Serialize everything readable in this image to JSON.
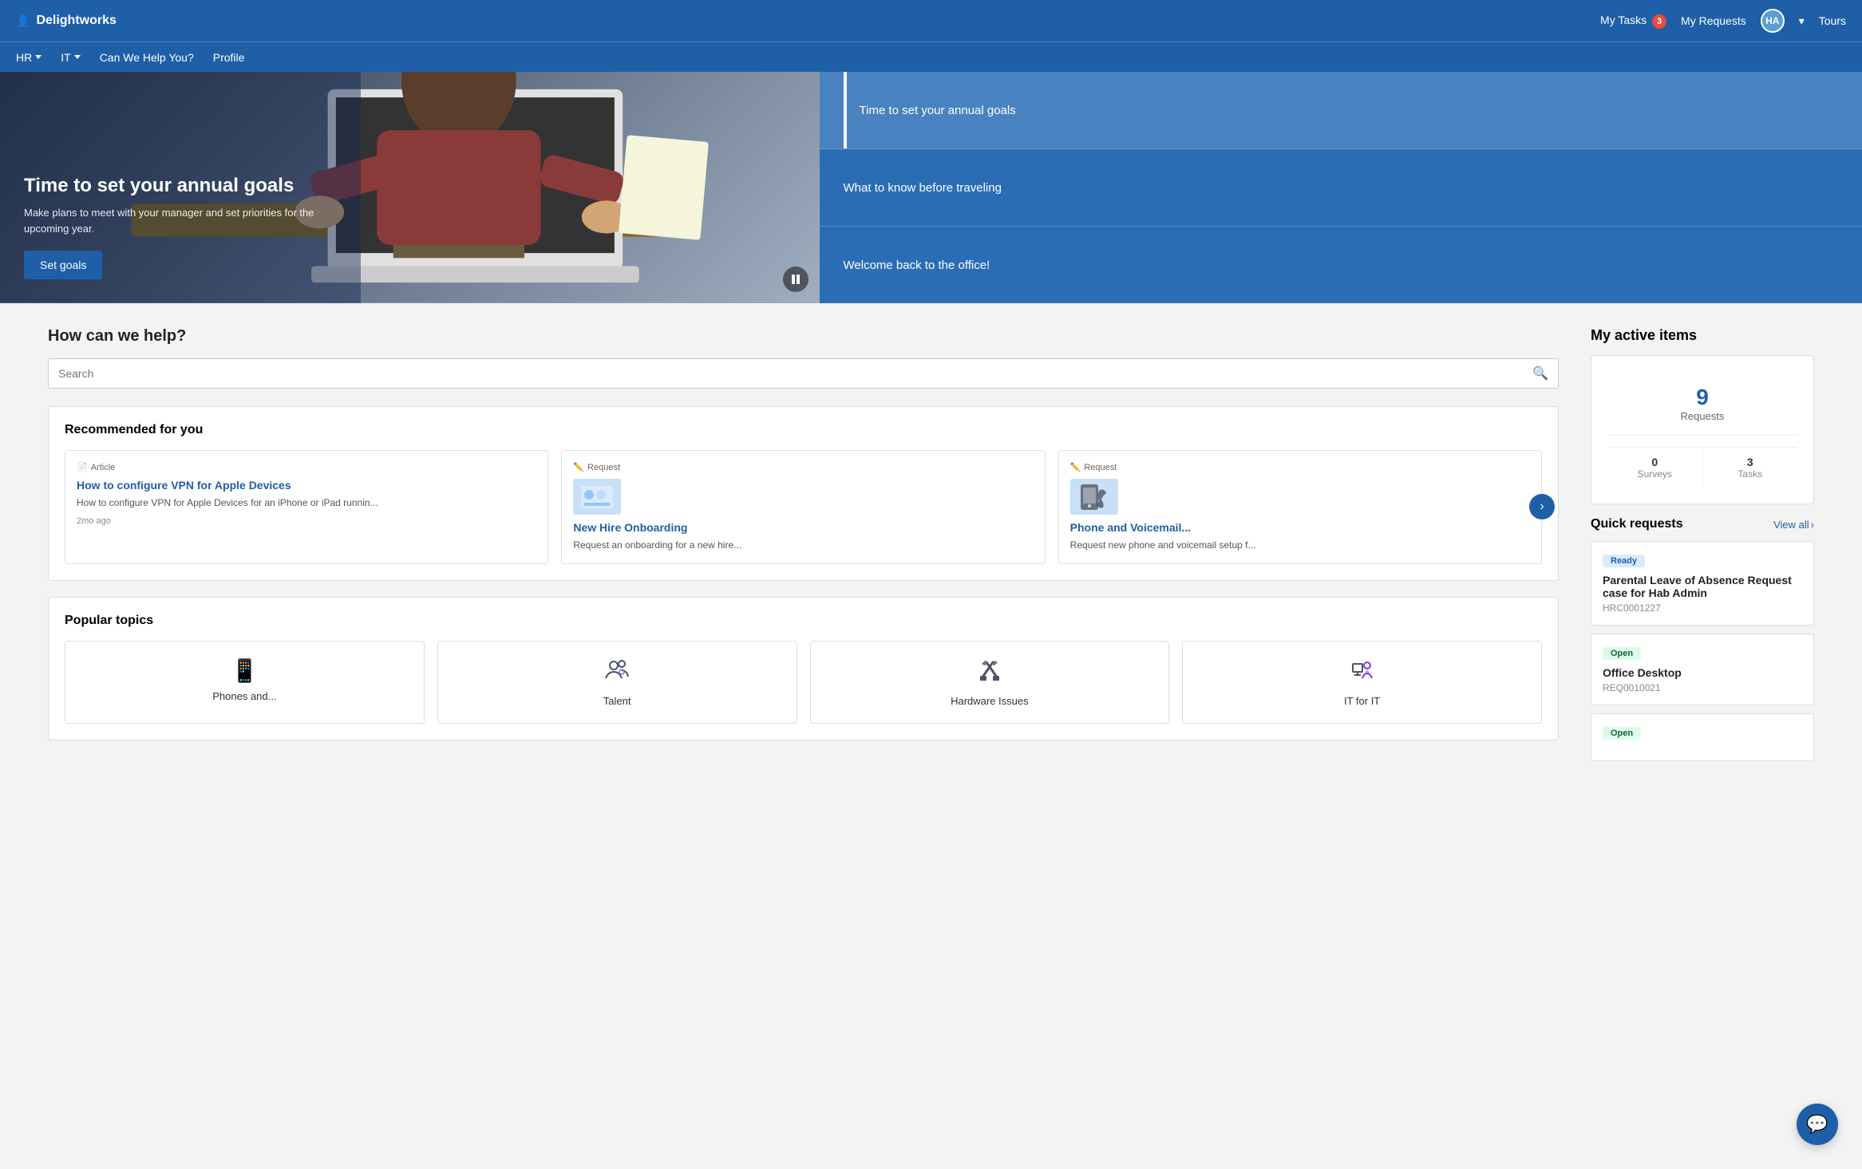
{
  "topbar": {
    "logo": "Delightworks",
    "logo_icon": "👤",
    "my_tasks": "My Tasks",
    "tasks_count": "3",
    "my_requests": "My Requests",
    "avatar_initials": "HA",
    "tours": "Tours",
    "dropdown_arrow": "▾"
  },
  "secondary_nav": {
    "items": [
      {
        "label": "HR",
        "has_dropdown": true
      },
      {
        "label": "IT",
        "has_dropdown": true
      },
      {
        "label": "Can We Help You?",
        "has_dropdown": false
      },
      {
        "label": "Profile",
        "has_dropdown": false
      }
    ]
  },
  "hero": {
    "title": "Time to set your annual goals",
    "subtitle": "Make plans to meet with your manager and set priorities for the upcoming year.",
    "cta_label": "Set goals",
    "sidebar_items": [
      {
        "label": "Time to set your annual goals",
        "active": true
      },
      {
        "label": "What to know before traveling",
        "active": false
      },
      {
        "label": "Welcome back to the office!",
        "active": false
      }
    ]
  },
  "help_section": {
    "title": "How can we help?",
    "search_placeholder": "Search"
  },
  "recommended": {
    "section_title": "Recommended for you",
    "next_btn": "›",
    "items": [
      {
        "type": "Article",
        "type_icon": "📄",
        "title": "How to configure VPN for Apple Devices",
        "desc": "How to configure VPN for Apple Devices for an iPhone or iPad runnin...",
        "date": "2mo ago",
        "has_image": false
      },
      {
        "type": "Request",
        "type_icon": "✏️",
        "title": "New Hire Onboarding",
        "desc": "Request an onboarding for a new hire...",
        "date": "",
        "has_image": true,
        "img_alt": "onboarding illustration"
      },
      {
        "type": "Request",
        "type_icon": "✏️",
        "title": "Phone and Voicemail...",
        "desc": "Request new phone and voicemail setup f...",
        "date": "",
        "has_image": true,
        "img_alt": "phone illustration"
      }
    ]
  },
  "popular_topics": {
    "section_title": "Popular topics",
    "items": [
      {
        "label": "Phones and...",
        "icon": "📱"
      },
      {
        "label": "Talent",
        "icon": "👥"
      },
      {
        "label": "Hardware Issues",
        "icon": "🔧"
      },
      {
        "label": "IT for IT",
        "icon": "💻"
      }
    ]
  },
  "active_items": {
    "title": "My active items",
    "requests_count": "9",
    "requests_label": "Requests",
    "surveys_count": "0",
    "surveys_label": "Surveys",
    "tasks_count": "3",
    "tasks_label": "Tasks",
    "quick_requests": {
      "title": "Quick requests",
      "view_all": "View all",
      "items": [
        {
          "status": "Ready",
          "status_class": "badge-ready",
          "title": "Parental Leave of Absence Request case for Hab Admin",
          "id": "HRC0001227"
        },
        {
          "status": "Open",
          "status_class": "badge-open",
          "title": "Office Desktop",
          "id": "REQ0010021"
        },
        {
          "status": "Open",
          "status_class": "badge-open",
          "title": "",
          "id": ""
        }
      ]
    }
  },
  "chat": {
    "icon": "💬"
  }
}
